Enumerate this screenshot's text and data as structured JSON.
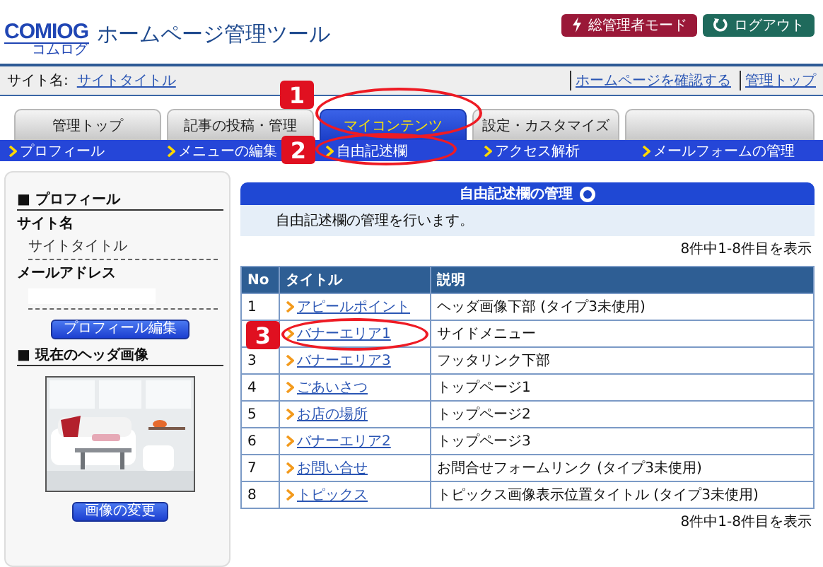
{
  "header": {
    "logo": "COMIOG",
    "logo_sub": "コムログ",
    "title": "ホームページ管理ツール",
    "buttons": [
      {
        "label": "総管理者モード",
        "kind": "admin"
      },
      {
        "label": "ログアウト",
        "kind": "logout"
      }
    ]
  },
  "site_bar": {
    "label": "サイト名:",
    "site_link": "サイトタイトル",
    "links": [
      "ホームページを確認する",
      "管理トップ"
    ]
  },
  "tabs": [
    {
      "label": "管理トップ",
      "selected": false
    },
    {
      "label": "記事の投稿・管理",
      "selected": false
    },
    {
      "label": "マイコンテンツ",
      "selected": true
    },
    {
      "label": "設定・カスタマイズ",
      "selected": false
    }
  ],
  "subnav": [
    "プロフィール",
    "メニューの編集",
    "自由記述欄",
    "アクセス解析",
    "メールフォームの管理"
  ],
  "sidebar": {
    "profile_heading": "■ プロフィール",
    "fields": [
      {
        "label": "サイト名",
        "value": "サイトタイトル"
      },
      {
        "label": "メールアドレス"
      }
    ],
    "edit_button": "プロフィール編集",
    "image_heading": "■ 現在のヘッダ画像",
    "change_button": "画像の変更"
  },
  "panel": {
    "title": "自由記述欄の管理",
    "description": "自由記述欄の管理を行います。",
    "count_top": "8件中1-8件目を表示",
    "columns": [
      "No",
      "タイトル",
      "説明"
    ],
    "rows": [
      {
        "no": "1",
        "title": "アピールポイント",
        "description": "ヘッダ画像下部 (タイプ3未使用)"
      },
      {
        "title": "バナーエリア1",
        "description": "サイドメニュー"
      },
      {
        "no": "3",
        "title": "バナーエリア3",
        "description": "フッタリンク下部"
      },
      {
        "no": "4",
        "title": "ごあいさつ",
        "description": "トップページ1"
      },
      {
        "no": "5",
        "title": "お店の場所",
        "description": "トップページ2"
      },
      {
        "no": "6",
        "title": "バナーエリア2",
        "description": "トップページ3"
      },
      {
        "no": "7",
        "title": "お問い合せ",
        "description": "お問合せフォームリンク (タイプ3未使用)"
      },
      {
        "no": "8",
        "title": "トピックス",
        "description": "トピックス画像表示位置タイトル (タイプ3未使用)"
      }
    ],
    "count_bottom": "8件中1-8件目を表示"
  },
  "annotations": [
    {
      "label": "1"
    },
    {
      "label": "2"
    },
    {
      "label": "3"
    }
  ]
}
